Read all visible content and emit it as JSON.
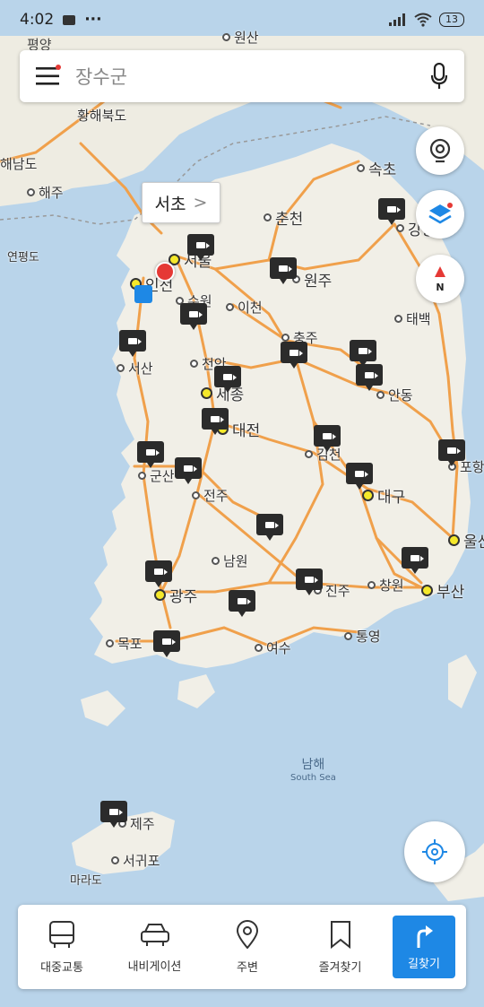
{
  "status_bar": {
    "time": "4:02",
    "more": "···",
    "battery": "13"
  },
  "search": {
    "placeholder": "장수군"
  },
  "tooltip": {
    "label": "서초",
    "chevron": ">"
  },
  "map": {
    "cities": [
      {
        "name": "원산",
        "dot": "gray"
      },
      {
        "name": "황해북도",
        "dot": "none"
      },
      {
        "name": "해남도",
        "dot": "none"
      },
      {
        "name": "해주",
        "dot": "gray"
      },
      {
        "name": "연평도",
        "dot": "none"
      },
      {
        "name": "속초",
        "dot": "gray"
      },
      {
        "name": "춘천",
        "dot": "gray"
      },
      {
        "name": "강릉",
        "dot": "gray"
      },
      {
        "name": "서울",
        "dot": "yellow"
      },
      {
        "name": "원주",
        "dot": "gray"
      },
      {
        "name": "인천",
        "dot": "yellow"
      },
      {
        "name": "수원",
        "dot": "gray"
      },
      {
        "name": "이천",
        "dot": "gray"
      },
      {
        "name": "태백",
        "dot": "gray"
      },
      {
        "name": "충주",
        "dot": "gray"
      },
      {
        "name": "서산",
        "dot": "gray"
      },
      {
        "name": "천안",
        "dot": "gray"
      },
      {
        "name": "세종",
        "dot": "yellow"
      },
      {
        "name": "안동",
        "dot": "gray"
      },
      {
        "name": "대전",
        "dot": "yellow"
      },
      {
        "name": "김천",
        "dot": "gray"
      },
      {
        "name": "포항",
        "dot": "gray"
      },
      {
        "name": "군산",
        "dot": "gray"
      },
      {
        "name": "대구",
        "dot": "yellow"
      },
      {
        "name": "전주",
        "dot": "gray"
      },
      {
        "name": "울산",
        "dot": "yellow"
      },
      {
        "name": "남원",
        "dot": "gray"
      },
      {
        "name": "광주",
        "dot": "yellow"
      },
      {
        "name": "진주",
        "dot": "gray"
      },
      {
        "name": "창원",
        "dot": "gray"
      },
      {
        "name": "부산",
        "dot": "yellow"
      },
      {
        "name": "목포",
        "dot": "gray"
      },
      {
        "name": "여수",
        "dot": "gray"
      },
      {
        "name": "통영",
        "dot": "gray"
      },
      {
        "name": "제주",
        "dot": "gray"
      },
      {
        "name": "서귀포",
        "dot": "gray"
      },
      {
        "name": "마라도",
        "dot": "none"
      }
    ],
    "sea": {
      "name": "남해",
      "name_en": "South Sea"
    },
    "partial_top_label": "평양"
  },
  "nav": {
    "items": [
      {
        "label": "대중교통",
        "icon": "bus-icon"
      },
      {
        "label": "내비게이션",
        "icon": "car-icon"
      },
      {
        "label": "주변",
        "icon": "location-pin-icon"
      },
      {
        "label": "즐겨찾기",
        "icon": "bookmark-icon"
      }
    ],
    "primary": {
      "label": "길찾기",
      "icon": "turn-arrow-icon"
    }
  },
  "colors": {
    "sea": "#b9d4ea",
    "land": "#f0eee6",
    "road": "#f0a04b",
    "accent": "#1e88e5",
    "marker": "#e53935",
    "compass_needle": "#e53935"
  }
}
